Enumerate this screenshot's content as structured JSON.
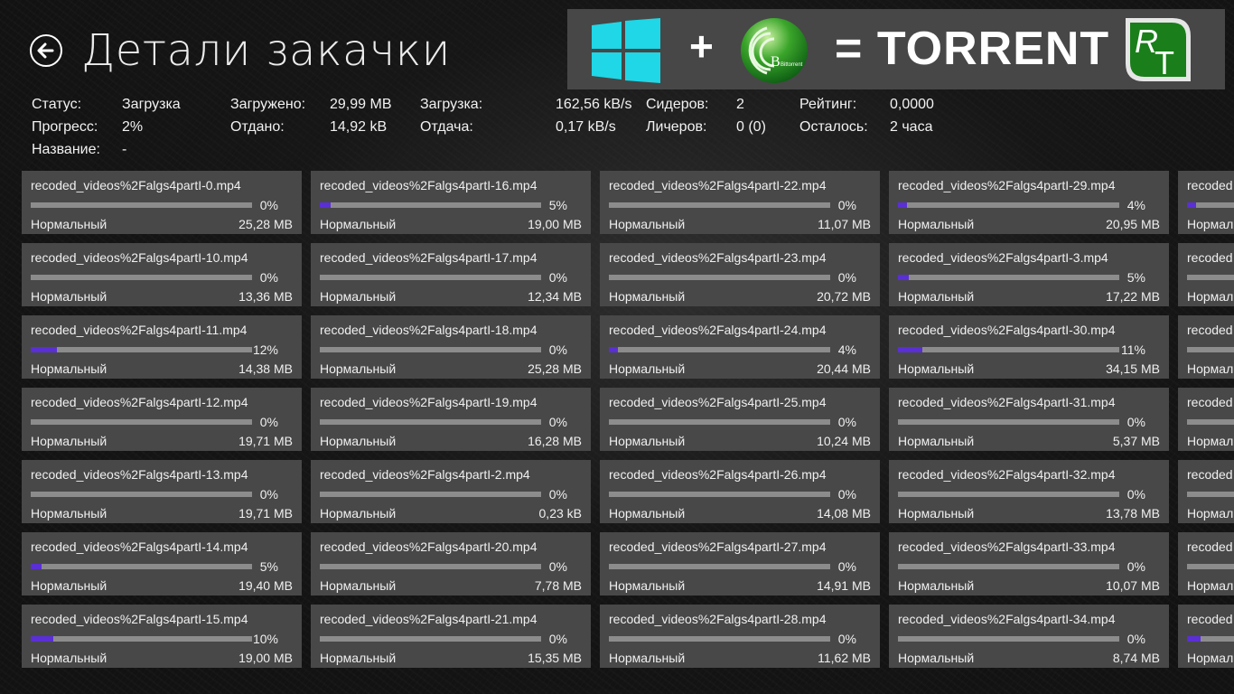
{
  "header": {
    "title": "Детали закачки",
    "back_label": "Назад"
  },
  "banner": {
    "plus": "+",
    "text": "= TORRENT",
    "bittorrent_label": "Bittorrent",
    "rt_logo": "RT",
    "windows_logo_color": "#1fd7e6",
    "rt_green": "#1a7f1a"
  },
  "stats": {
    "status": {
      "label": "Статус:",
      "value": "Загрузка"
    },
    "progress": {
      "label": "Прогресс:",
      "value": "2%"
    },
    "name": {
      "label": "Название:",
      "value": "-"
    },
    "downloaded": {
      "label": "Загружено:",
      "value": "29,99 MB"
    },
    "uploaded": {
      "label": "Отдано:",
      "value": "14,92 kB"
    },
    "download_speed": {
      "label": "Загрузка:",
      "value": "162,56 kB/s"
    },
    "upload_speed": {
      "label": "Отдача:",
      "value": "0,17 kB/s"
    },
    "seeders": {
      "label": "Сидеров:",
      "value": "2"
    },
    "leechers": {
      "label": "Личеров:",
      "value": "0 (0)"
    },
    "rating": {
      "label": "Рейтинг:",
      "value": "0,0000"
    },
    "remaining": {
      "label": "Осталось:",
      "value": "2 часа"
    }
  },
  "colors": {
    "progress_fill": "#5b2fd6",
    "progress_track": "#8c8c8c",
    "tile_bg": "#484848"
  },
  "files": [
    [
      {
        "name": "recoded_videos%2Falgs4partI-0.mp4",
        "percent": 0,
        "percent_label": "0%",
        "priority": "Нормальный",
        "size": "25,28 MB"
      },
      {
        "name": "recoded_videos%2Falgs4partI-10.mp4",
        "percent": 0,
        "percent_label": "0%",
        "priority": "Нормальный",
        "size": "13,36 MB"
      },
      {
        "name": "recoded_videos%2Falgs4partI-11.mp4",
        "percent": 12,
        "percent_label": "12%",
        "priority": "Нормальный",
        "size": "14,38 MB"
      },
      {
        "name": "recoded_videos%2Falgs4partI-12.mp4",
        "percent": 0,
        "percent_label": "0%",
        "priority": "Нормальный",
        "size": "19,71 MB"
      },
      {
        "name": "recoded_videos%2Falgs4partI-13.mp4",
        "percent": 0,
        "percent_label": "0%",
        "priority": "Нормальный",
        "size": "19,71 MB"
      },
      {
        "name": "recoded_videos%2Falgs4partI-14.mp4",
        "percent": 5,
        "percent_label": "5%",
        "priority": "Нормальный",
        "size": "19,40 MB"
      },
      {
        "name": "recoded_videos%2Falgs4partI-15.mp4",
        "percent": 10,
        "percent_label": "10%",
        "priority": "Нормальный",
        "size": "19,00 MB"
      }
    ],
    [
      {
        "name": "recoded_videos%2Falgs4partI-16.mp4",
        "percent": 5,
        "percent_label": "5%",
        "priority": "Нормальный",
        "size": "19,00 MB"
      },
      {
        "name": "recoded_videos%2Falgs4partI-17.mp4",
        "percent": 0,
        "percent_label": "0%",
        "priority": "Нормальный",
        "size": "12,34 MB"
      },
      {
        "name": "recoded_videos%2Falgs4partI-18.mp4",
        "percent": 0,
        "percent_label": "0%",
        "priority": "Нормальный",
        "size": "25,28 MB"
      },
      {
        "name": "recoded_videos%2Falgs4partI-19.mp4",
        "percent": 0,
        "percent_label": "0%",
        "priority": "Нормальный",
        "size": "16,28 MB"
      },
      {
        "name": "recoded_videos%2Falgs4partI-2.mp4",
        "percent": 0,
        "percent_label": "0%",
        "priority": "Нормальный",
        "size": "0,23 kB"
      },
      {
        "name": "recoded_videos%2Falgs4partI-20.mp4",
        "percent": 0,
        "percent_label": "0%",
        "priority": "Нормальный",
        "size": "7,78 MB"
      },
      {
        "name": "recoded_videos%2Falgs4partI-21.mp4",
        "percent": 0,
        "percent_label": "0%",
        "priority": "Нормальный",
        "size": "15,35 MB"
      }
    ],
    [
      {
        "name": "recoded_videos%2Falgs4partI-22.mp4",
        "percent": 0,
        "percent_label": "0%",
        "priority": "Нормальный",
        "size": "11,07 MB"
      },
      {
        "name": "recoded_videos%2Falgs4partI-23.mp4",
        "percent": 0,
        "percent_label": "0%",
        "priority": "Нормальный",
        "size": "20,72 MB"
      },
      {
        "name": "recoded_videos%2Falgs4partI-24.mp4",
        "percent": 4,
        "percent_label": "4%",
        "priority": "Нормальный",
        "size": "20,44 MB"
      },
      {
        "name": "recoded_videos%2Falgs4partI-25.mp4",
        "percent": 0,
        "percent_label": "0%",
        "priority": "Нормальный",
        "size": "10,24 MB"
      },
      {
        "name": "recoded_videos%2Falgs4partI-26.mp4",
        "percent": 0,
        "percent_label": "0%",
        "priority": "Нормальный",
        "size": "14,08 MB"
      },
      {
        "name": "recoded_videos%2Falgs4partI-27.mp4",
        "percent": 0,
        "percent_label": "0%",
        "priority": "Нормальный",
        "size": "14,91 MB"
      },
      {
        "name": "recoded_videos%2Falgs4partI-28.mp4",
        "percent": 0,
        "percent_label": "0%",
        "priority": "Нормальный",
        "size": "11,62 MB"
      }
    ],
    [
      {
        "name": "recoded_videos%2Falgs4partI-29.mp4",
        "percent": 4,
        "percent_label": "4%",
        "priority": "Нормальный",
        "size": "20,95 MB"
      },
      {
        "name": "recoded_videos%2Falgs4partI-3.mp4",
        "percent": 5,
        "percent_label": "5%",
        "priority": "Нормальный",
        "size": "17,22 MB"
      },
      {
        "name": "recoded_videos%2Falgs4partI-30.mp4",
        "percent": 11,
        "percent_label": "11%",
        "priority": "Нормальный",
        "size": "34,15 MB"
      },
      {
        "name": "recoded_videos%2Falgs4partI-31.mp4",
        "percent": 0,
        "percent_label": "0%",
        "priority": "Нормальный",
        "size": "5,37 MB"
      },
      {
        "name": "recoded_videos%2Falgs4partI-32.mp4",
        "percent": 0,
        "percent_label": "0%",
        "priority": "Нормальный",
        "size": "13,78 MB"
      },
      {
        "name": "recoded_videos%2Falgs4partI-33.mp4",
        "percent": 0,
        "percent_label": "0%",
        "priority": "Нормальный",
        "size": "10,07 MB"
      },
      {
        "name": "recoded_videos%2Falgs4partI-34.mp4",
        "percent": 0,
        "percent_label": "0%",
        "priority": "Нормальный",
        "size": "8,74 MB"
      }
    ],
    [
      {
        "name": "recoded",
        "percent": 4,
        "percent_label": "",
        "priority": "Нормал",
        "size": ""
      },
      {
        "name": "recoded",
        "percent": 0,
        "percent_label": "",
        "priority": "Нормал",
        "size": ""
      },
      {
        "name": "recoded",
        "percent": 0,
        "percent_label": "",
        "priority": "Нормал",
        "size": ""
      },
      {
        "name": "recoded",
        "percent": 0,
        "percent_label": "",
        "priority": "Нормал",
        "size": ""
      },
      {
        "name": "recoded",
        "percent": 0,
        "percent_label": "",
        "priority": "Нормал",
        "size": ""
      },
      {
        "name": "recoded",
        "percent": 0,
        "percent_label": "",
        "priority": "Нормал",
        "size": ""
      },
      {
        "name": "recoded",
        "percent": 6,
        "percent_label": "",
        "priority": "Нормал",
        "size": ""
      }
    ]
  ]
}
